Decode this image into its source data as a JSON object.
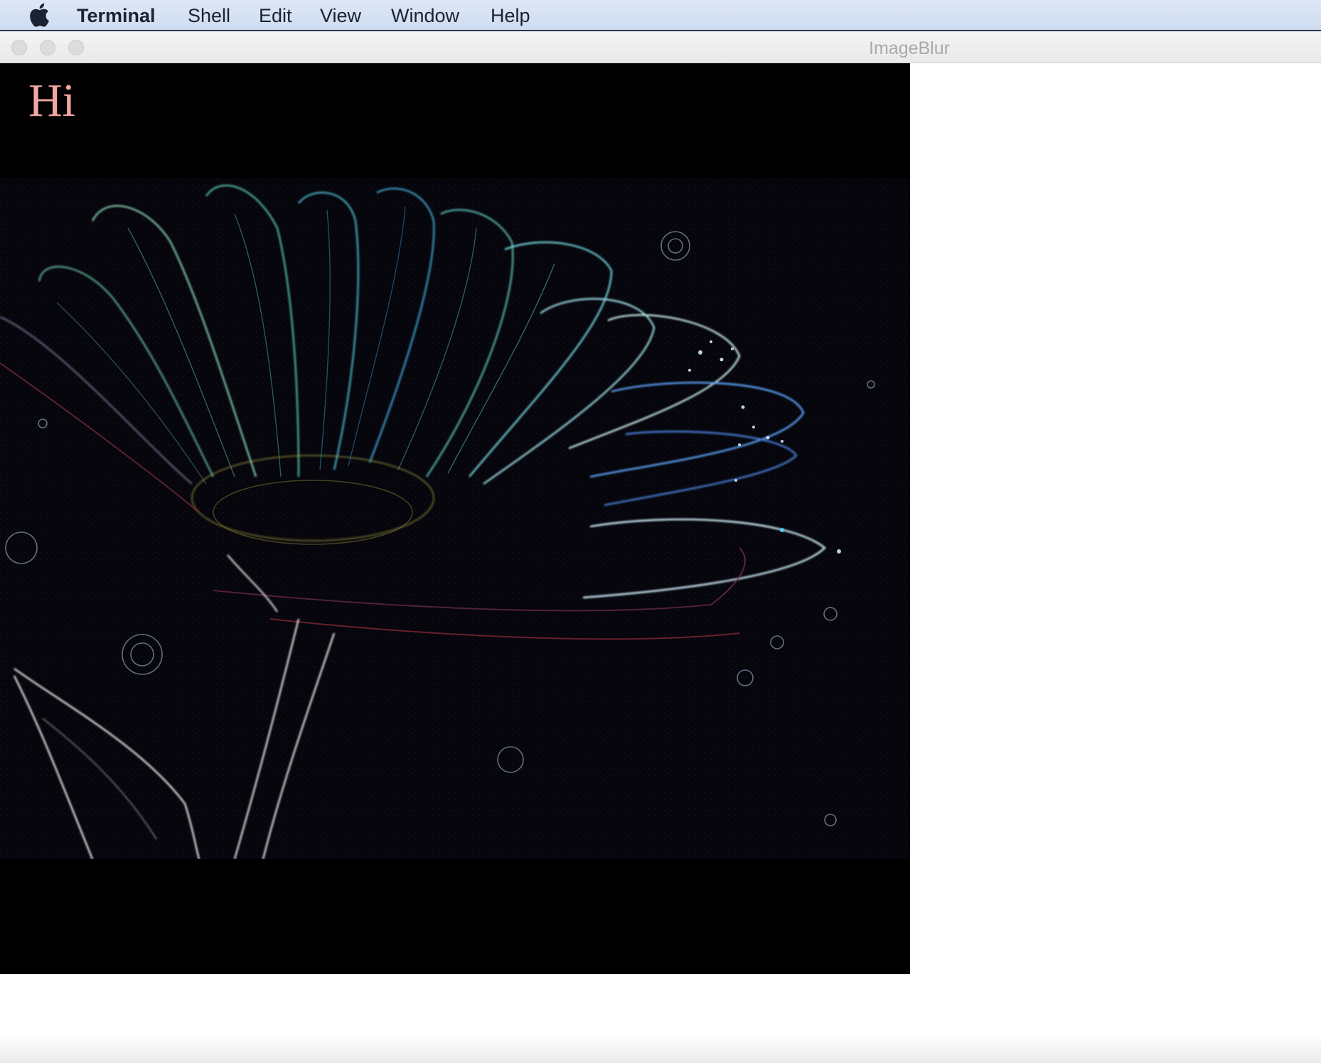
{
  "menubar": {
    "apple_icon": "apple-logo-icon",
    "app_name": "Terminal",
    "items": [
      "Shell",
      "Edit",
      "View",
      "Window",
      "Help"
    ]
  },
  "window": {
    "title": "ImageBlur",
    "controls": [
      "close-button",
      "minimize-button",
      "zoom-button"
    ]
  },
  "canvas": {
    "label": "Hi",
    "label_color": "#f3a7a2",
    "image_description_icon": "edge-detected-flower-image"
  }
}
